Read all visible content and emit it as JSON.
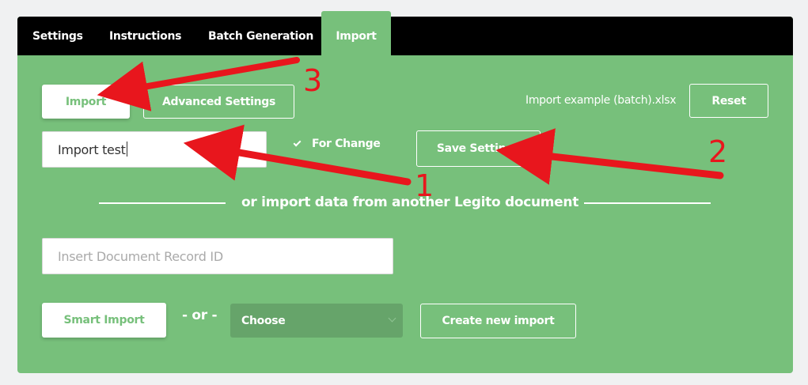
{
  "tabs": [
    {
      "label": "Settings"
    },
    {
      "label": "Instructions"
    },
    {
      "label": "Batch Generation"
    },
    {
      "label": "Import",
      "active": true
    }
  ],
  "toolbar": {
    "import_label": "Import",
    "advanced_label": "Advanced Settings",
    "example_link": "Import example (batch).xlsx",
    "reset_label": "Reset"
  },
  "settings": {
    "name_value": "Import test",
    "for_change_label": "For Change",
    "for_change_checked": true,
    "save_label": "Save Settings"
  },
  "divider": {
    "text": "or import data from another Legito document"
  },
  "record": {
    "placeholder": "Insert Document Record ID"
  },
  "bottom": {
    "smart_import_label": "Smart Import",
    "or_label": "- or -",
    "select_value": "Choose",
    "create_label": "Create new import"
  },
  "annotations": [
    "1",
    "2",
    "3"
  ],
  "colors": {
    "panel_green": "#77c07b",
    "tabbar_black": "#000000",
    "select_green": "#66a46a",
    "annotation_red": "#e8161d"
  }
}
